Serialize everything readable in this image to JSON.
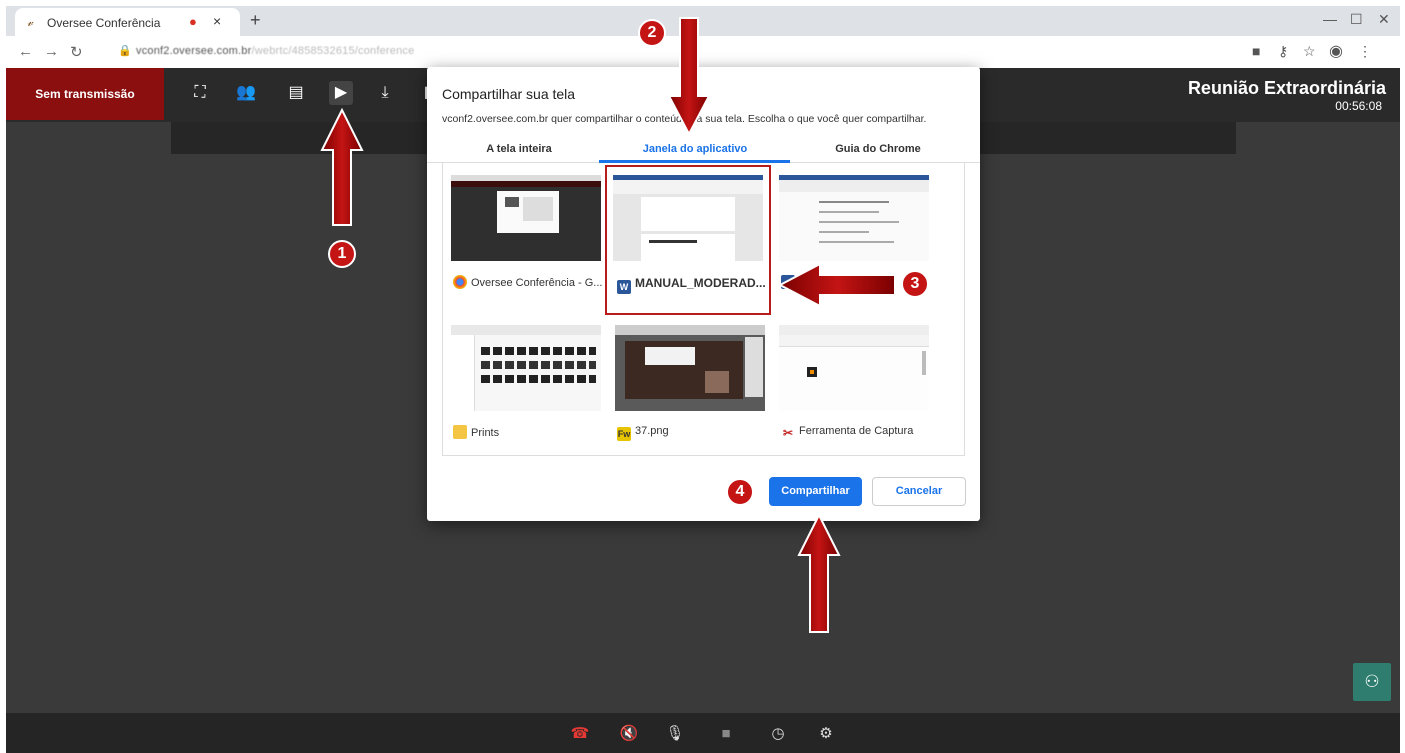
{
  "browser": {
    "tab_title": "Oversee Conferência",
    "tab_close": "×",
    "new_tab": "+",
    "url_host": "vconf2.oversee.com.br",
    "url_path": "/webrtc/4858532615/conference",
    "window_controls": [
      "—",
      "☐",
      "✕"
    ]
  },
  "app": {
    "live_button": "Sem transmissão",
    "meeting_title": "Reunião Extraordinária",
    "meeting_time": "00:56:08"
  },
  "dialog": {
    "title": "Compartilhar sua tela",
    "description": "vconf2.oversee.com.br quer compartilhar o conteúdo da sua tela. Escolha o que você quer compartilhar.",
    "tabs": [
      "A tela inteira",
      "Janela do aplicativo",
      "Guia do Chrome"
    ],
    "active_tab": 1,
    "windows": [
      {
        "label": "Oversee Conferência - G...",
        "icon": "chrome-icon"
      },
      {
        "label": "MANUAL_MODERAD...",
        "icon": "word-icon",
        "selected": true
      },
      {
        "label": "",
        "icon": "word-icon"
      },
      {
        "label": "Prints",
        "icon": "folder-icon"
      },
      {
        "label": "37.png",
        "icon": "fireworks-icon"
      },
      {
        "label": "Ferramenta de Captura",
        "icon": "snipping-tool-icon"
      }
    ],
    "share_button": "Compartilhar",
    "cancel_button": "Cancelar"
  },
  "annotations": [
    "1",
    "2",
    "3",
    "4"
  ],
  "colors": {
    "live_button": "#8b0f0f",
    "accent": "#1a73e8",
    "annotation": "#c41414",
    "user_button": "#2e7d6e"
  }
}
